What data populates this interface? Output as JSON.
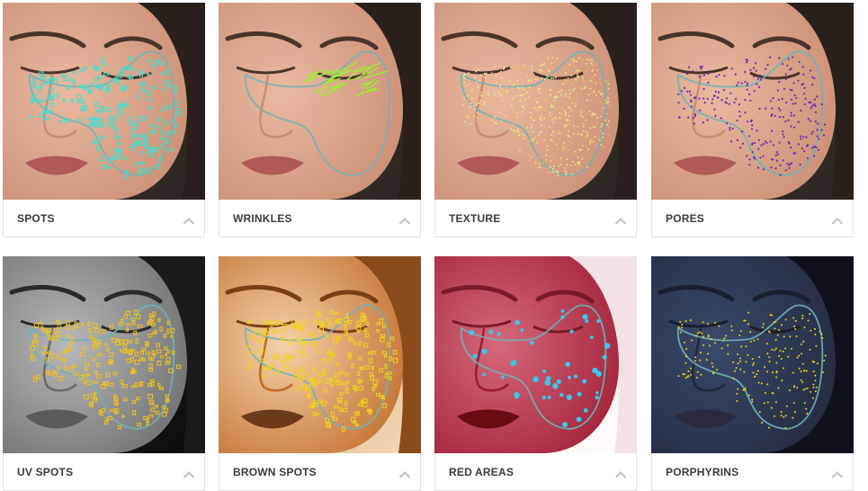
{
  "panels": [
    {
      "label": "SPOTS",
      "style": "natural",
      "overlay": "spots",
      "overlay_color": "#3fe0d0"
    },
    {
      "label": "WRINKLES",
      "style": "natural",
      "overlay": "wrinkles",
      "overlay_color": "#9cf02a"
    },
    {
      "label": "TEXTURE",
      "style": "natural",
      "overlay": "texture",
      "overlay_color": "#e6f08a"
    },
    {
      "label": "PORES",
      "style": "natural",
      "overlay": "pores",
      "overlay_color": "#6a2bb8"
    },
    {
      "label": "UV SPOTS",
      "style": "uv",
      "overlay": "spots",
      "overlay_color": "#f2c21a"
    },
    {
      "label": "BROWN SPOTS",
      "style": "brown",
      "overlay": "spots",
      "overlay_color": "#f2d21a"
    },
    {
      "label": "RED AREAS",
      "style": "red",
      "overlay": "red",
      "overlay_color": "#38c8e8"
    },
    {
      "label": "PORPHYRINS",
      "style": "porph",
      "overlay": "dots",
      "overlay_color": "#f2d21a"
    }
  ],
  "icons": {
    "expand": "chevron-up-icon"
  },
  "colors": {
    "outline": "#6fb3b8",
    "label": "#3b3b3b",
    "chevron": "#c4c4c4"
  }
}
